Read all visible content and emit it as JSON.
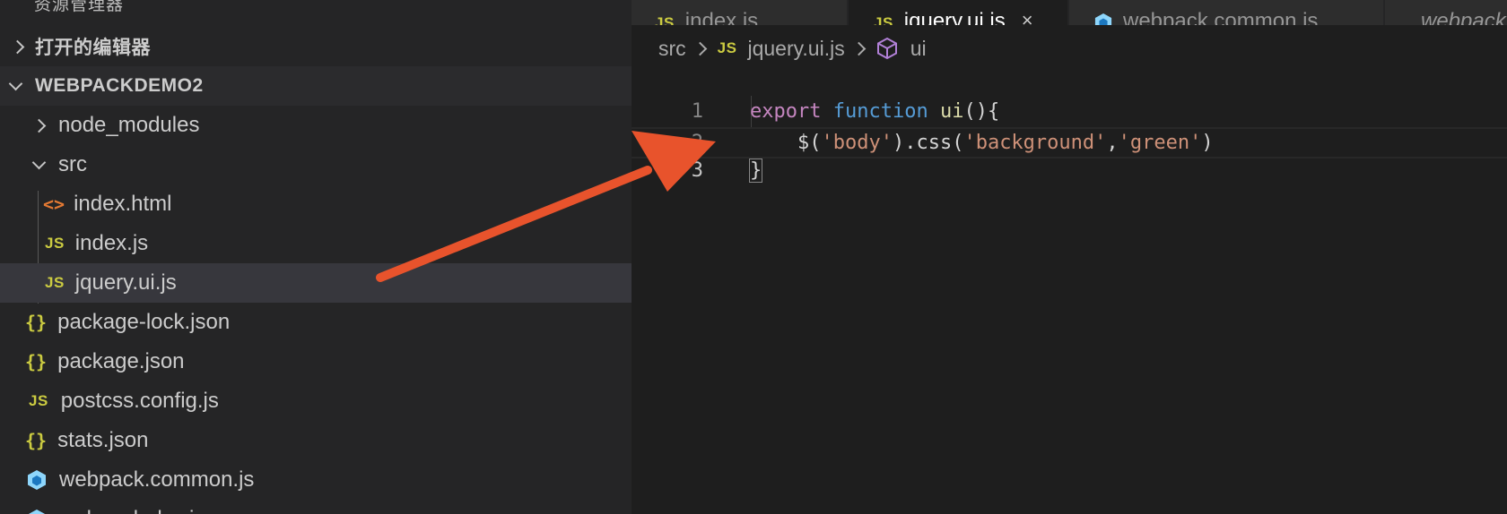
{
  "sidebar": {
    "title": "资源管理器",
    "open_editors": "打开的编辑器",
    "project": "WEBPACKDEMO2",
    "items": [
      {
        "label": "node_modules",
        "icon": "chevron-right-icon"
      },
      {
        "label": "src",
        "icon": "chevron-down-icon"
      },
      {
        "label": "index.html",
        "icon": "html-file-icon",
        "glyph": "<>"
      },
      {
        "label": "index.js",
        "icon": "js-file-icon",
        "glyph": "JS"
      },
      {
        "label": "jquery.ui.js",
        "icon": "js-file-icon",
        "glyph": "JS"
      },
      {
        "label": "package-lock.json",
        "icon": "json-file-icon",
        "glyph": "{}"
      },
      {
        "label": "package.json",
        "icon": "json-file-icon",
        "glyph": "{}"
      },
      {
        "label": "postcss.config.js",
        "icon": "js-file-icon",
        "glyph": "JS"
      },
      {
        "label": "stats.json",
        "icon": "json-file-icon",
        "glyph": "{}"
      },
      {
        "label": "webpack.common.js",
        "icon": "webpack-cube-icon"
      },
      {
        "label": "webpack.dev.js",
        "icon": "webpack-cube-icon"
      }
    ]
  },
  "tabs": [
    {
      "label": "index.js",
      "glyph": "JS"
    },
    {
      "label": "jquery.ui.js",
      "glyph": "JS",
      "close": "×"
    },
    {
      "label": "webpack.common.js"
    },
    {
      "label": "webpack.dev.js"
    }
  ],
  "breadcrumb": {
    "folder": "src",
    "file_glyph": "JS",
    "file": "jquery.ui.js",
    "symbol": "ui"
  },
  "code": {
    "lines": [
      {
        "n": "1",
        "kw": "export",
        "kw2": "function",
        "fn": "ui",
        "rest": "(){"
      },
      {
        "n": "2",
        "indent": "    ",
        "a": "$(",
        "s1": "'body'",
        "b": ").css(",
        "s2": "'background'",
        "c": ",",
        "s3": "'green'",
        "d": ")"
      },
      {
        "n": "3",
        "brace": "}"
      }
    ]
  },
  "colors": {
    "sidebar_bg": "#252526",
    "editor_bg": "#1e1e1e",
    "selected_row": "#37373d",
    "annotation_arrow": "#e8532c",
    "js_icon": "#cbcb41",
    "html_icon": "#e37933",
    "webpack_icon": "#8ed6fb"
  }
}
